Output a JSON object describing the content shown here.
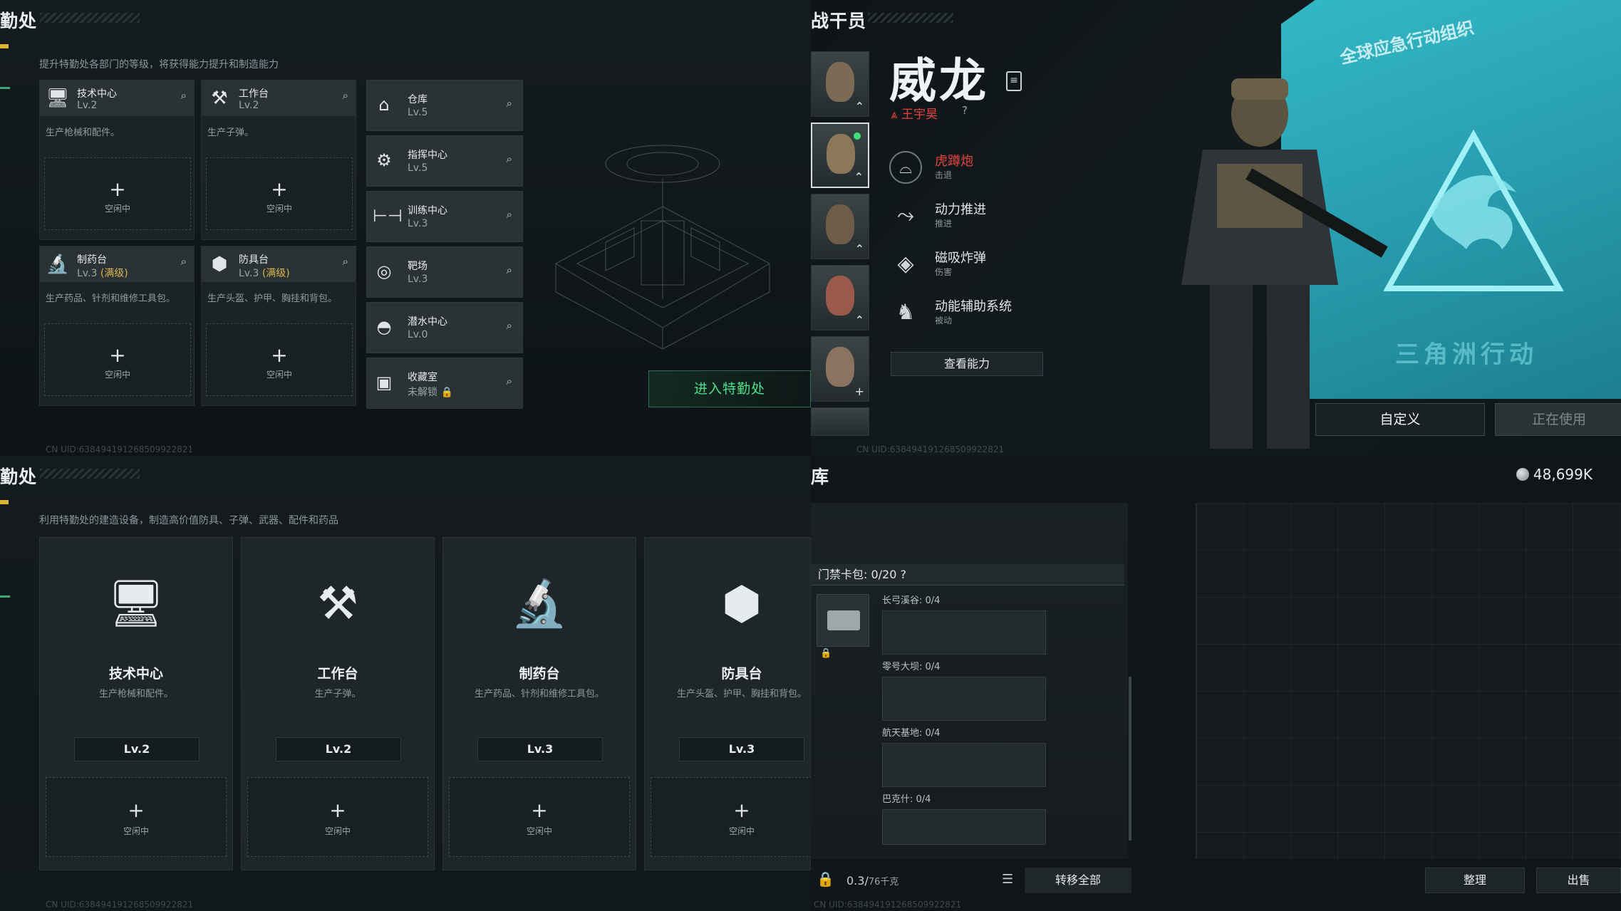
{
  "top_left": {
    "title": "勤处",
    "description": "提升特勤处各部门的等级，将获得能力提升和制造能力",
    "uid": "CN UID:638494191268509922821",
    "enter_button": "进入特勤处",
    "cards": [
      {
        "name": "技术中心",
        "level": "Lv.2",
        "max": "",
        "desc": "生产枪械和配件。",
        "slot": "空闲中",
        "icon": "monitor-icon"
      },
      {
        "name": "工作台",
        "level": "Lv.2",
        "max": "",
        "desc": "生产子弹。",
        "slot": "空闲中",
        "icon": "hammer-wrench-icon"
      },
      {
        "name": "制药台",
        "level": "Lv.3",
        "max": "(满级)",
        "desc": "生产药品、针剂和维修工具包。",
        "slot": "空闲中",
        "icon": "microscope-icon"
      },
      {
        "name": "防具台",
        "level": "Lv.3",
        "max": "(满级)",
        "desc": "生产头盔、护甲、胸挂和背包。",
        "slot": "空闲中",
        "icon": "cubes-icon"
      }
    ],
    "side_cards": [
      {
        "name": "仓库",
        "level": "Lv.5",
        "icon": "warehouse-icon"
      },
      {
        "name": "指挥中心",
        "level": "Lv.5",
        "icon": "gear-icon"
      },
      {
        "name": "训练中心",
        "level": "Lv.3",
        "icon": "dumbbell-icon"
      },
      {
        "name": "靶场",
        "level": "Lv.3",
        "icon": "target-icon"
      },
      {
        "name": "潜水中心",
        "level": "Lv.0",
        "icon": "diving-icon"
      },
      {
        "name": "收藏室",
        "level": "未解锁",
        "icon": "collection-icon"
      }
    ]
  },
  "top_right": {
    "title": "战干员",
    "operator_name": "威龙",
    "operator_sub": "王宇昊",
    "operator_q": "?",
    "abilities": [
      {
        "name": "虎蹲炮",
        "type": "击退",
        "icon": "cannon-icon",
        "highlight": true
      },
      {
        "name": "动力推进",
        "type": "推进",
        "icon": "thrust-icon",
        "highlight": false
      },
      {
        "name": "磁吸炸弹",
        "type": "伤害",
        "icon": "bomb-icon",
        "highlight": false
      },
      {
        "name": "动能辅助系统",
        "type": "被动",
        "icon": "exoskeleton-icon",
        "highlight": false
      }
    ],
    "view_abilities": "查看能力",
    "customize": "自定义",
    "in_use": "正在使用",
    "banner_text": "全球应急行动组织",
    "banner_bottom": "三角洲行动",
    "uid": "CN UID:638494191268509922821"
  },
  "bottom_left": {
    "title": "勤处",
    "description": "利用特勤处的建造设备，制造高价值防具、子弹、武器、配件和药品",
    "uid": "CN UID:638494191268509922821",
    "cards": [
      {
        "name": "技术中心",
        "desc": "生产枪械和配件。",
        "level": "Lv.2",
        "slot": "空闲中",
        "icon": "monitor-icon"
      },
      {
        "name": "工作台",
        "desc": "生产子弹。",
        "level": "Lv.2",
        "slot": "空闲中",
        "icon": "hammer-wrench-icon"
      },
      {
        "name": "制药台",
        "desc": "生产药品、针剂和维修工具包。",
        "level": "Lv.3",
        "slot": "空闲中",
        "icon": "microscope-icon"
      },
      {
        "name": "防具台",
        "desc": "生产头盔、护甲、胸挂和背包。",
        "level": "Lv.3",
        "slot": "空闲中",
        "icon": "cubes-icon"
      }
    ]
  },
  "bottom_right": {
    "title": "库",
    "money": "48,699K",
    "card_pack": "门禁卡包: 0/20",
    "card_pack_q": "?",
    "categories": [
      {
        "label": "长弓溪谷: 0/4"
      },
      {
        "label": "零号大坝: 0/4"
      },
      {
        "label": "航天基地: 0/4"
      },
      {
        "label": "巴克什: 0/4"
      }
    ],
    "weight": "0.3/",
    "weight_max": "76千克",
    "transfer_all": "转移全部",
    "sort": "整理",
    "sell": "出售",
    "uid": "CN UID:638494191268509922821"
  }
}
